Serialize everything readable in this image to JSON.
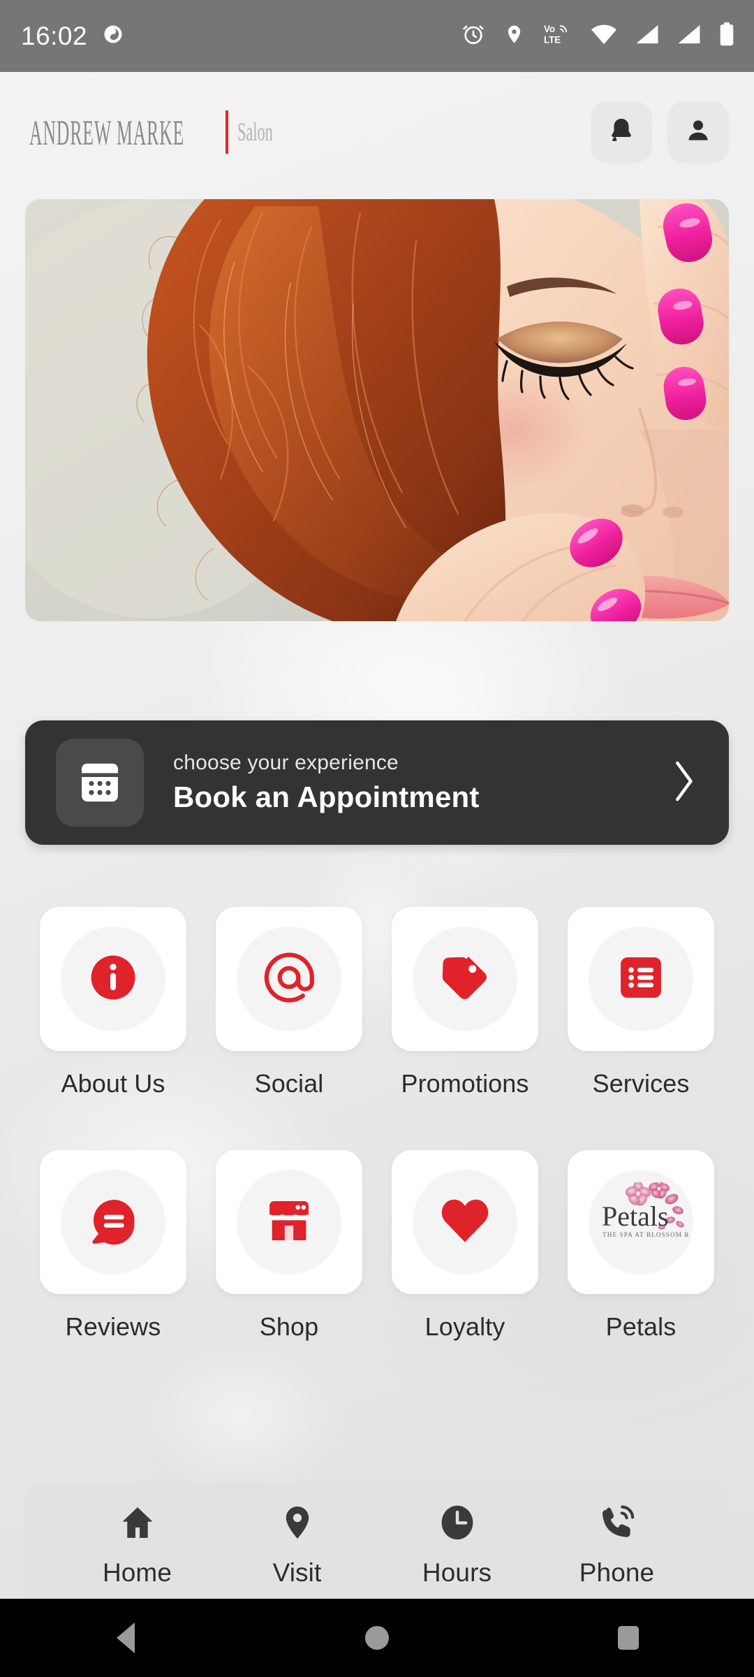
{
  "status_bar": {
    "time": "16:02",
    "left_icons": [
      "screen-record-icon"
    ],
    "right_icons": [
      "alarm-icon",
      "location-icon",
      "volte-icon",
      "wifi-icon",
      "signal-1-icon",
      "signal-2-icon",
      "battery-icon"
    ],
    "volte_top": "Vo",
    "volte_bottom": "LTE",
    "background": "#767676"
  },
  "header": {
    "logo_main": "ANDREW MARKE",
    "logo_divider_color": "#e3242b",
    "logo_sub": "Salon",
    "notifications_label": "Notifications",
    "account_label": "Account"
  },
  "hero": {
    "alt": "Woman with red curly hair, gold eye makeup and pink manicure"
  },
  "banner": {
    "icon": "calendar-icon",
    "subtitle": "choose your experience",
    "title": "Book an Appointment",
    "chevron": "chevron-right-icon",
    "background": "#333333"
  },
  "accent_color": "#e0222a",
  "grid": {
    "rows": [
      [
        {
          "label": "About Us",
          "icon": "info-icon"
        },
        {
          "label": "Social",
          "icon": "at-sign-icon"
        },
        {
          "label": "Promotions",
          "icon": "price-tag-icon"
        },
        {
          "label": "Services",
          "icon": "list-icon"
        }
      ],
      [
        {
          "label": "Reviews",
          "icon": "chat-bubble-icon"
        },
        {
          "label": "Shop",
          "icon": "storefront-icon"
        },
        {
          "label": "Loyalty",
          "icon": "heart-icon"
        },
        {
          "label": "Petals",
          "icon": "petals-logo-icon"
        }
      ]
    ]
  },
  "petals_logo": {
    "name": "Petals",
    "tagline": "THE SPA AT BLOSSOM RIDGE"
  },
  "bottom_nav": {
    "items": [
      {
        "label": "Home",
        "icon": "home-icon"
      },
      {
        "label": "Visit",
        "icon": "map-pin-icon"
      },
      {
        "label": "Hours",
        "icon": "clock-icon"
      },
      {
        "label": "Phone",
        "icon": "phone-icon"
      }
    ]
  },
  "android_nav": {
    "back": "Back",
    "home": "Home",
    "recents": "Recents"
  }
}
